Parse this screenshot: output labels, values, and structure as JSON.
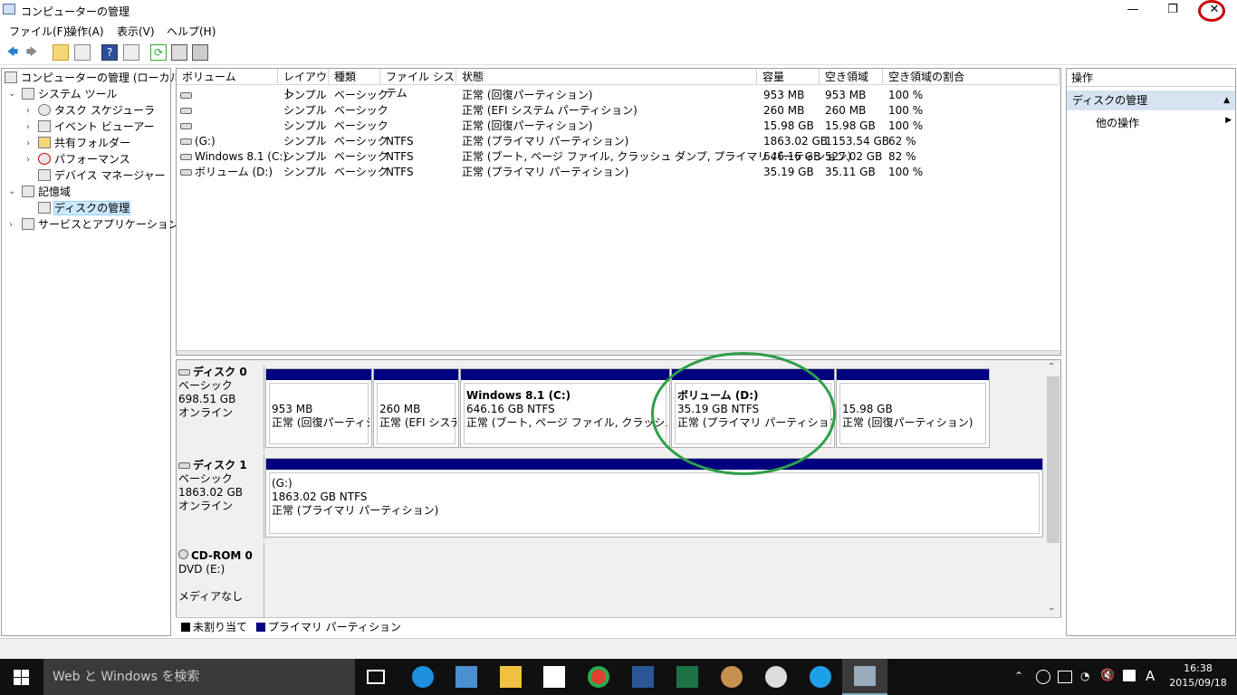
{
  "window": {
    "title": "コンピューターの管理",
    "minimize": "—",
    "restore": "❐",
    "close": "✕"
  },
  "menu": [
    "ファイル(F)",
    "操作(A)",
    "表示(V)",
    "ヘルプ(H)"
  ],
  "toolbar": {
    "back": "🡄",
    "forward": "🡆",
    "up": "▲",
    "refresh": "⟳",
    "help": "?"
  },
  "tree": {
    "root": "コンピューターの管理 (ローカル)",
    "system_tools": "システム ツール",
    "task_scheduler": "タスク スケジューラ",
    "event_viewer": "イベント ビューアー",
    "shared_folders": "共有フォルダー",
    "performance": "パフォーマンス",
    "device_manager": "デバイス マネージャー",
    "storage": "記憶域",
    "disk_management": "ディスクの管理",
    "services": "サービスとアプリケーション"
  },
  "volumes": {
    "headers": [
      "ボリューム",
      "レイアウト",
      "種類",
      "ファイル システム",
      "状態",
      "容量",
      "空き領域",
      "空き領域の割合"
    ],
    "rows": [
      [
        "",
        "シンプル",
        "ベーシック",
        "",
        "正常 (回復パーティション)",
        "953 MB",
        "953 MB",
        "100 %"
      ],
      [
        "",
        "シンプル",
        "ベーシック",
        "",
        "正常 (EFI システム パーティション)",
        "260 MB",
        "260 MB",
        "100 %"
      ],
      [
        "",
        "シンプル",
        "ベーシック",
        "",
        "正常 (回復パーティション)",
        "15.98 GB",
        "15.98 GB",
        "100 %"
      ],
      [
        "(G:)",
        "シンプル",
        "ベーシック",
        "NTFS",
        "正常 (プライマリ パーティション)",
        "1863.02 GB",
        "1153.54 GB",
        "62 %"
      ],
      [
        "Windows 8.1 (C:)",
        "シンプル",
        "ベーシック",
        "NTFS",
        "正常 (ブート, ページ ファイル, クラッシュ ダンプ, プライマリ パーティション)",
        "646.16 GB",
        "527.02 GB",
        "82 %"
      ],
      [
        "ボリューム (D:)",
        "シンプル",
        "ベーシック",
        "NTFS",
        "正常 (プライマリ パーティション)",
        "35.19 GB",
        "35.11 GB",
        "100 %"
      ]
    ]
  },
  "disks": [
    {
      "name": "ディスク 0",
      "type": "ベーシック",
      "size": "698.51 GB",
      "status": "オンライン",
      "parts": [
        {
          "name": "",
          "size": "953 MB",
          "status": "正常 (回復パーティション)"
        },
        {
          "name": "",
          "size": "260 MB",
          "status": "正常 (EFI システム パーティション)"
        },
        {
          "name": "Windows 8.1  (C:)",
          "size": "646.16 GB NTFS",
          "status": "正常 (ブート, ページ ファイル, クラッシュ ダンプ, プライマリ パーティション)"
        },
        {
          "name": "ボリューム  (D:)",
          "size": "35.19 GB NTFS",
          "status": "正常 (プライマリ パーティション)"
        },
        {
          "name": "",
          "size": "15.98 GB",
          "status": "正常 (回復パーティション)"
        }
      ]
    },
    {
      "name": "ディスク 1",
      "type": "ベーシック",
      "size": "1863.02 GB",
      "status": "オンライン",
      "parts": [
        {
          "name": " (G:)",
          "size": "1863.02 GB NTFS",
          "status": "正常 (プライマリ パーティション)"
        }
      ]
    },
    {
      "name": "CD-ROM 0",
      "type": "DVD (E:)",
      "size": "",
      "status": "メディアなし",
      "parts": []
    }
  ],
  "legend": {
    "unallocated": "未割り当て",
    "primary": "プライマリ パーティション"
  },
  "actions": {
    "header": "操作",
    "section": "ディスクの管理",
    "more": "他の操作"
  },
  "taskbar": {
    "search_placeholder": "Web と Windows を検索",
    "time": "16:38",
    "date": "2015/09/18",
    "ime": "A"
  },
  "colors": {
    "partition_bar": "#00007f",
    "annotation_red": "#cc0000",
    "annotation_green": "#2e9e4a"
  }
}
